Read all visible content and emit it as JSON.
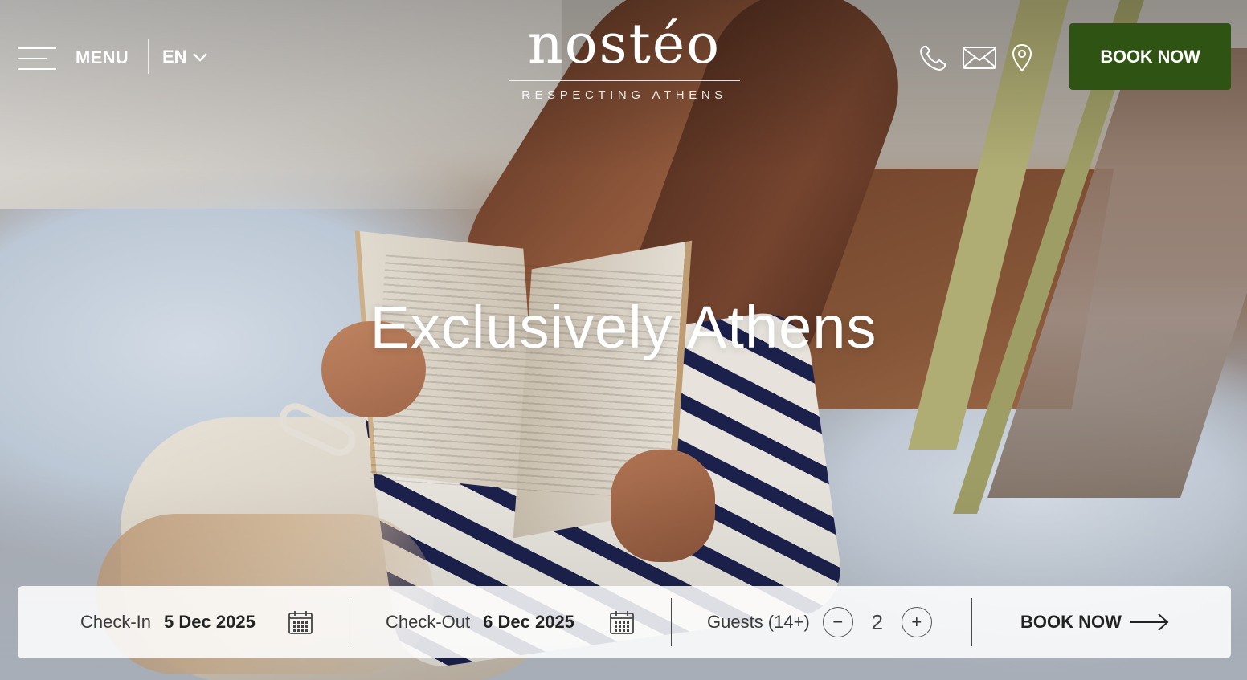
{
  "header": {
    "menu_label": "MENU",
    "language": "EN",
    "logo_word": "nostéo",
    "logo_tagline": "RESPECTING ATHENS",
    "icons": [
      "phone-icon",
      "mail-icon",
      "location-pin-icon"
    ],
    "book_now_label": "BOOK NOW"
  },
  "hero": {
    "headline": "Exclusively Athens"
  },
  "booking_bar": {
    "check_in": {
      "label": "Check-In",
      "value": "5 Dec 2025"
    },
    "check_out": {
      "label": "Check-Out",
      "value": "6 Dec 2025"
    },
    "guests": {
      "label": "Guests (14+)",
      "count": "2",
      "decrement_symbol": "−",
      "increment_symbol": "+"
    },
    "book_now_label": "BOOK NOW"
  },
  "colors": {
    "book_button": "#2f5312",
    "bar_background": "rgba(255,255,255,0.86)"
  }
}
